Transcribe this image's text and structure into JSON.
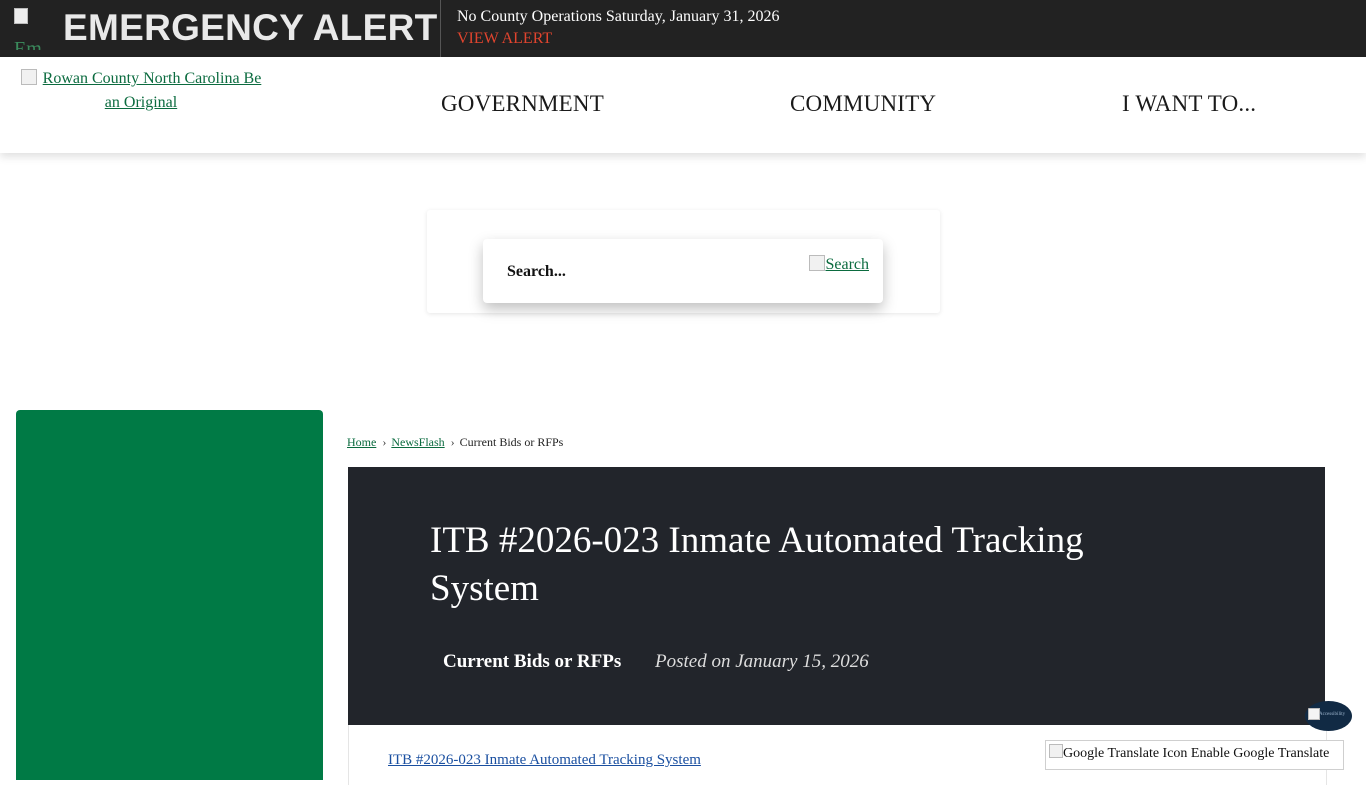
{
  "alert": {
    "icon_alt": "Em",
    "title": "EMERGENCY ALERT",
    "message": "No County Operations Saturday, January 31, 2026",
    "link": "VIEW ALERT"
  },
  "header": {
    "logo_alt": "Rowan County North Carolina Be an Original",
    "nav": [
      "GOVERNMENT",
      "COMMUNITY",
      "I WANT TO..."
    ]
  },
  "search": {
    "placeholder": "Search...",
    "button_alt": "Search"
  },
  "breadcrumb": {
    "home": "Home",
    "newsflash": "NewsFlash",
    "current": "Current Bids or RFPs",
    "separator": "›"
  },
  "article": {
    "title": "ITB #2026-023 Inmate Automated Tracking System",
    "category": "Current Bids or RFPs",
    "posted": "Posted on January 15, 2026",
    "link_text": "ITB #2026-023 Inmate Automated Tracking System"
  },
  "translate": {
    "label": "Google Translate Icon Enable Google Translate"
  },
  "float_widget": {
    "alt": "Accessibility"
  },
  "colors": {
    "alert_bg": "#222222",
    "alert_link": "#e0442e",
    "brand_green": "#007a45",
    "hero_bg": "#22252b"
  }
}
